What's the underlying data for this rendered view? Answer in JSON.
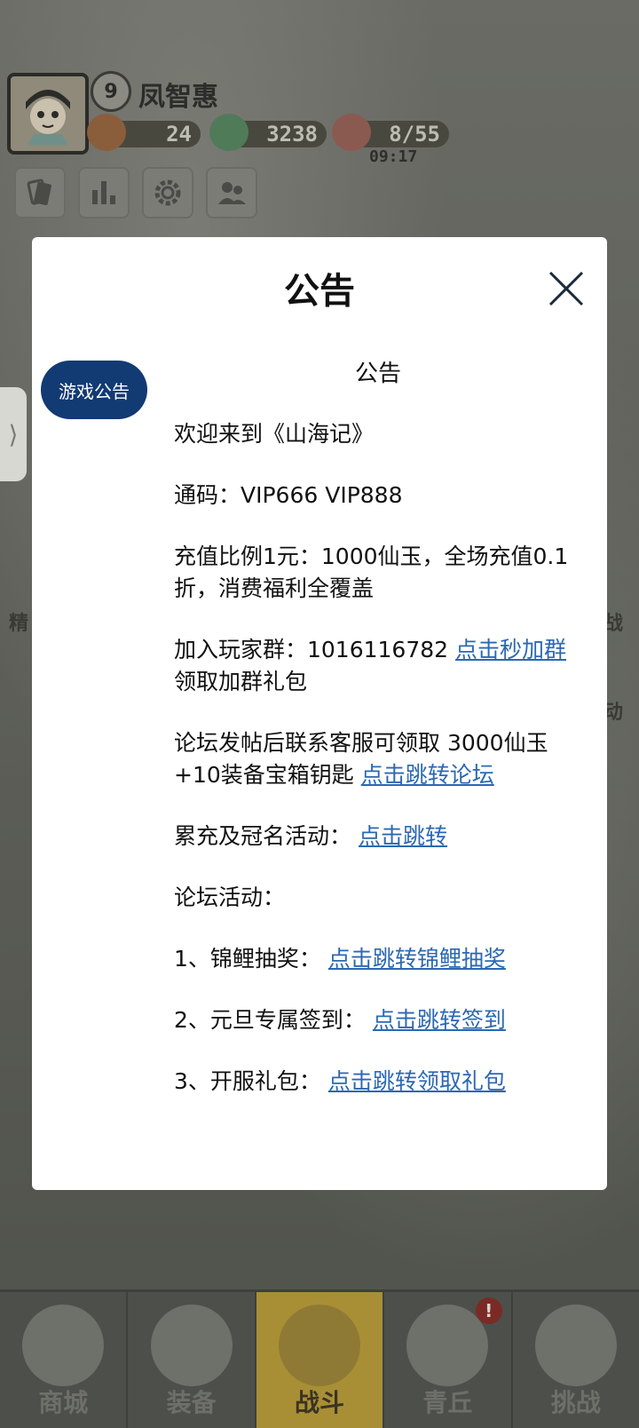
{
  "player": {
    "level": "9",
    "name": "凤智惠",
    "resources": {
      "gift": "24",
      "jade": "3238",
      "stamina": "8/55",
      "stamina_timer": "09:17"
    }
  },
  "modal": {
    "title": "公告",
    "category_tab": "游戏公告",
    "notice_heading": "公告",
    "welcome": "欢迎来到《山海记》",
    "codes": "通码：VIP666 VIP888",
    "recharge": "充值比例1元：1000仙玉，全场充值0.1折，消费福利全覆盖",
    "group_text": "加入玩家群：1016116782",
    "group_link": "点击秒加群",
    "group_suffix": "领取加群礼包",
    "forum_text": "论坛发帖后联系客服可领取 3000仙玉+10装备宝箱钥匙",
    "forum_link": "点击跳转论坛",
    "event_text": "累充及冠名活动：",
    "event_link": "点击跳转",
    "forum_activities": "论坛活动：",
    "activity1_text": "1、锦鲤抽奖：",
    "activity1_link": "点击跳转锦鲤抽奖",
    "activity2_text": "2、元旦专属签到：",
    "activity2_link": "点击跳转签到",
    "activity3_text": "3、开服礼包：",
    "activity3_link": "点击跳转领取礼包"
  },
  "side_tab_arrow": "⟩",
  "bg_labels": {
    "left": "精",
    "right1": "战",
    "right2": "动"
  },
  "bottom_nav": {
    "items": [
      "商城",
      "装备",
      "战斗",
      "青丘",
      "挑战"
    ],
    "active": "战斗",
    "alert": "!"
  },
  "colors": {
    "accent_tab": "#123a73",
    "link": "#2b68b3",
    "active_nav": "#a88f36"
  }
}
